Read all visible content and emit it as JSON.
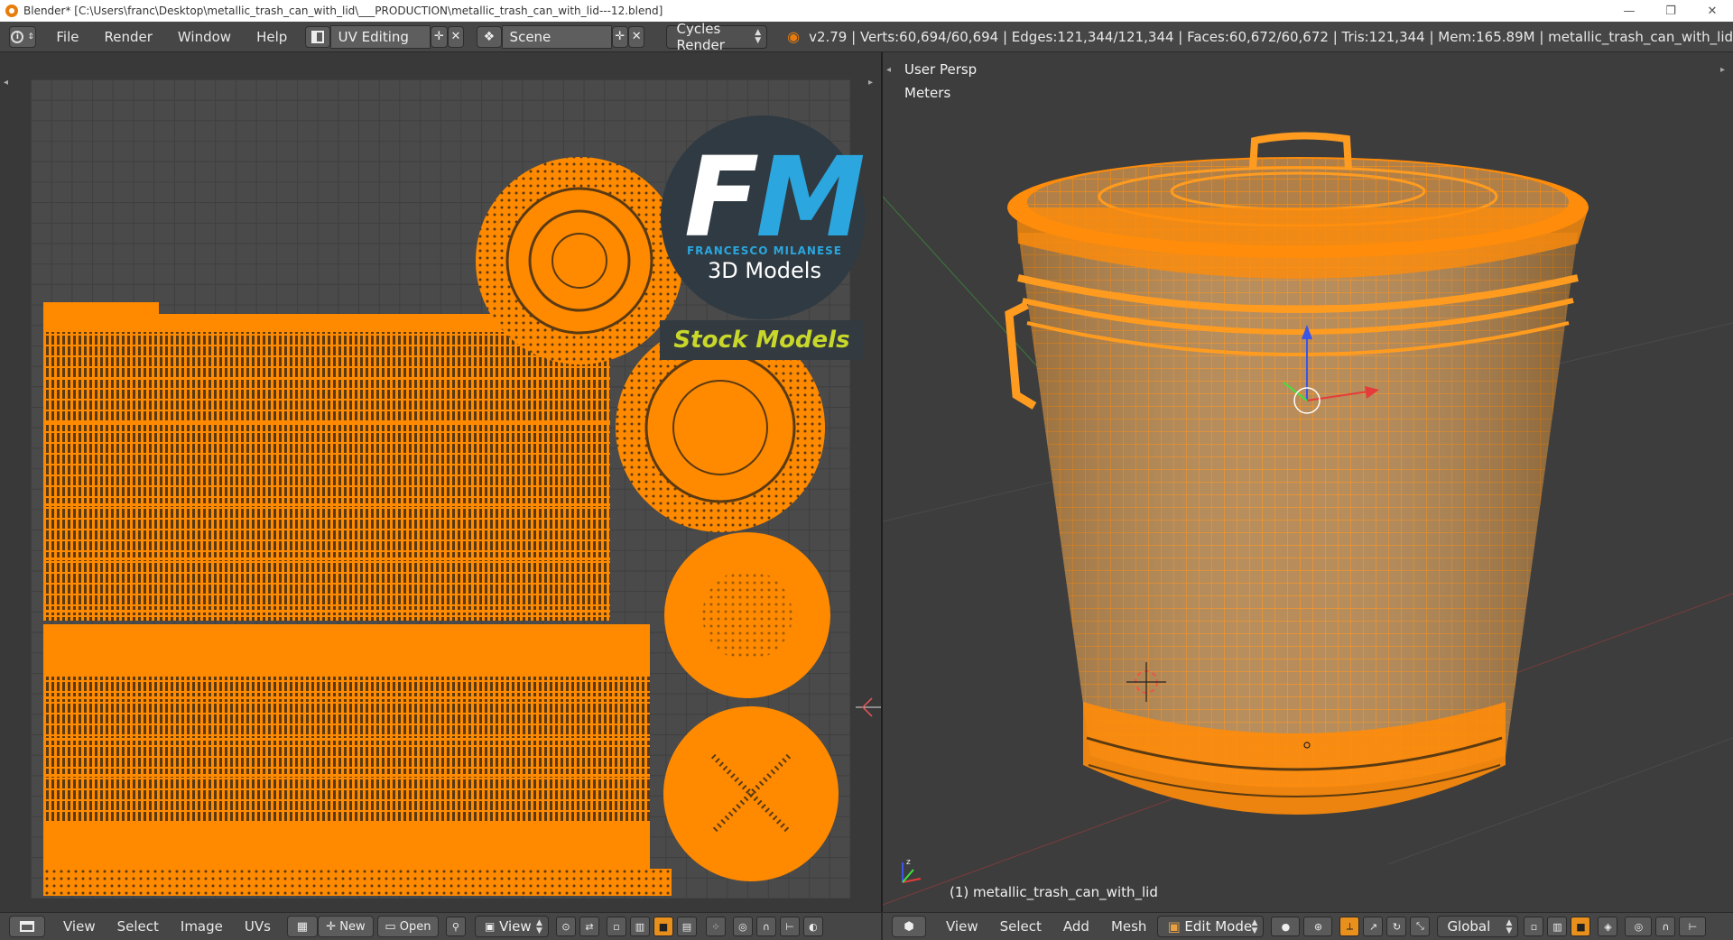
{
  "window": {
    "title": "Blender* [C:\\Users\\franc\\Desktop\\metallic_trash_can_with_lid\\___PRODUCTION\\metallic_trash_can_with_lid---12.blend]",
    "controls": [
      "—",
      "❐",
      "✕"
    ]
  },
  "info_header": {
    "menus": [
      "File",
      "Render",
      "Window",
      "Help"
    ],
    "layout": "UV Editing",
    "scene": "Scene",
    "engine": "Cycles Render",
    "stats": "v2.79 | Verts:60,694/60,694 | Edges:121,344/121,344 | Faces:60,672/60,672 | Tris:121,344 | Mem:165.89M | metallic_trash_can_with_lid"
  },
  "uv_editor": {
    "header_menus": [
      "View",
      "Select",
      "Image",
      "UVs"
    ],
    "new_label": "New",
    "open_label": "Open",
    "view_label": "View"
  },
  "viewport": {
    "view_name": "User Persp",
    "units": "Meters",
    "object_label": "(1) metallic_trash_can_with_lid",
    "header_menus": [
      "View",
      "Select",
      "Add",
      "Mesh"
    ],
    "mode": "Edit Mode",
    "orientation": "Global"
  },
  "watermark": {
    "logo_f": "F",
    "logo_m": "M",
    "name": "FRANCESCO MILANESE",
    "subtitle": "3D Models",
    "stock": "Stock Models"
  },
  "colors": {
    "wire_orange": "#ff8c0a",
    "uv_fill": "#ff8a00",
    "logo_blue": "#2ba6de",
    "stock_green": "#c8d72a"
  }
}
